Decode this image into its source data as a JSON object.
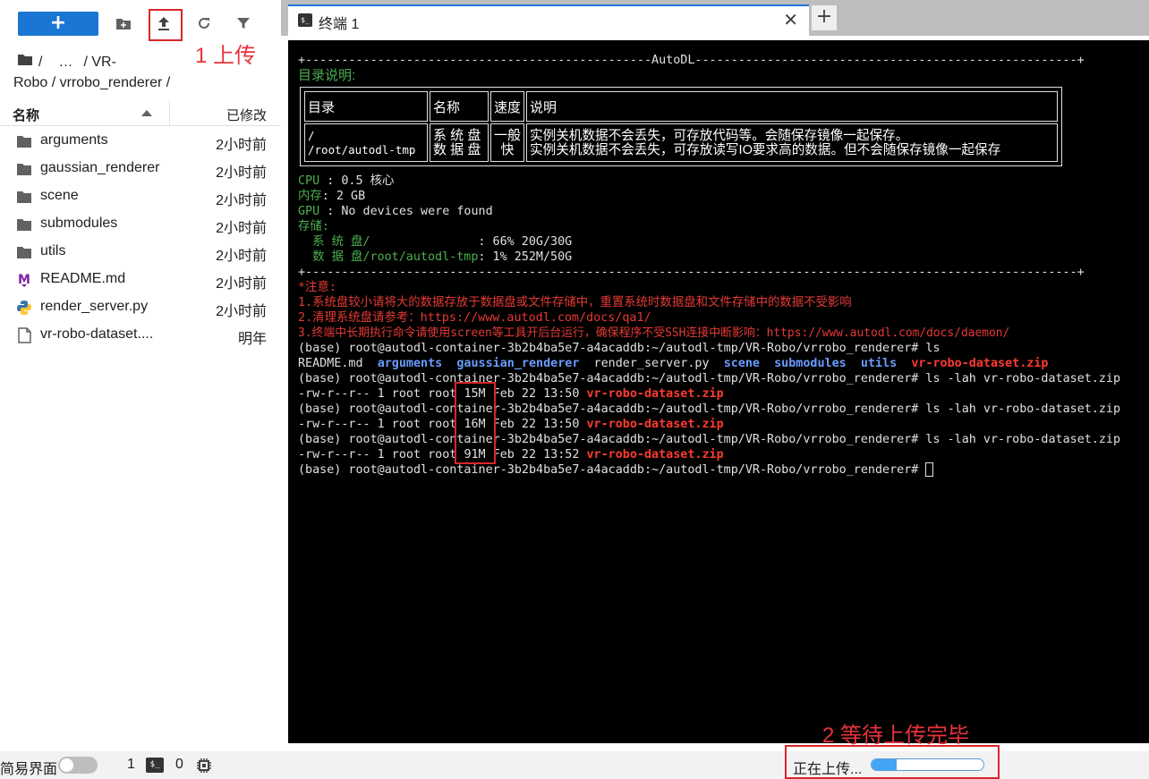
{
  "toolbar": {
    "new_label": "+",
    "icons": [
      "new-folder-icon",
      "upload-icon",
      "refresh-icon",
      "filter-icon"
    ]
  },
  "annotations": {
    "step1": "1 上传",
    "step2": "2 等待上传完毕",
    "color": "#e8333a"
  },
  "breadcrumb": {
    "root": "/",
    "ellipsis": "…",
    "line1_tail": "/ VR-",
    "line2": "Robo / vrrobo_renderer /"
  },
  "file_browser": {
    "col_name": "名称",
    "col_modified": "已修改",
    "files": [
      {
        "name": "arguments",
        "time": "2小时前",
        "icon": "folder-icon"
      },
      {
        "name": "gaussian_renderer",
        "time": "2小时前",
        "icon": "folder-icon"
      },
      {
        "name": "scene",
        "time": "2小时前",
        "icon": "folder-icon"
      },
      {
        "name": "submodules",
        "time": "2小时前",
        "icon": "folder-icon"
      },
      {
        "name": "utils",
        "time": "2小时前",
        "icon": "folder-icon"
      },
      {
        "name": "README.md",
        "time": "2小时前",
        "icon": "markdown-icon"
      },
      {
        "name": "render_server.py",
        "time": "2小时前",
        "icon": "python-icon"
      },
      {
        "name": "vr-robo-dataset....",
        "time": "明年",
        "icon": "file-icon"
      }
    ]
  },
  "tab": {
    "title": "终端 1",
    "icon_text": "$_",
    "close": "✕",
    "add": "+"
  },
  "terminal": {
    "banner_top": "+------------------------------------------------AutoDL-----------------------------------------------------+",
    "dir_title": "目录说明:",
    "table": {
      "headers": [
        "目录",
        "名称",
        "速度",
        "说明"
      ],
      "paths": [
        "/",
        "/root/autodl-tmp"
      ],
      "names": [
        "系 统 盘",
        "数 据 盘"
      ],
      "speed": [
        "一般",
        "快"
      ],
      "desc": [
        "实例关机数据不会丢失，可存放代码等。会随保存镜像一起保存。",
        "实例关机数据不会丢失，可存放读写IO要求高的数据。但不会随保存镜像一起保存"
      ]
    },
    "cpu_label": "CPU",
    "cpu_value": " : 0.5 核心",
    "mem_label": "内存",
    "mem_value": ": 2 GB",
    "gpu_label": "GPU",
    "gpu_value": " : No devices were found",
    "storage_label": "存储:",
    "sys_disk_label": "  系 统 盘/",
    "sys_disk_value": "               : 66% 20G/30G",
    "data_disk_label": "  数 据 盘/root/autodl-tmp",
    "data_disk_value": ": 1% 252M/50G",
    "banner_bottom": "+-----------------------------------------------------------------------------------------------------------+",
    "notice_title": "*注意:",
    "notice_1": "1.系统盘较小请将大的数据存放于数据盘或文件存储中，重置系统时数据盘和文件存储中的数据不受影响",
    "notice_2": "2.清理系统盘请参考：https://www.autodl.com/docs/qa1/",
    "notice_3": "3.终端中长期执行命令请使用screen等工具开后台运行，确保程序不受SSH连接中断影响：https://www.autodl.com/docs/daemon/",
    "prompt": "(base) root@autodl-container-3b2b4ba5e7-a4acaddb:~/autodl-tmp/VR-Robo/vrrobo_renderer#",
    "cmd_ls": " ls",
    "ls_plain_1": "README.md  ",
    "ls_dir_1": "arguments",
    "ls_dir_2": "gaussian_renderer",
    "ls_plain_2": "  render_server.py  ",
    "ls_dir_3": "scene",
    "ls_dir_4": "submodules",
    "ls_dir_5": "utils",
    "ls_zip": "vr-robo-dataset.zip",
    "cmd_lah": " ls -lah vr-robo-dataset.zip",
    "lah_prefix": "-rw-r--r-- 1 root root ",
    "lah_rows": [
      {
        "size": "15M",
        "date": " Feb 22 13:50 "
      },
      {
        "size": "16M",
        "date": " Feb 22 13:50 "
      },
      {
        "size": "91M",
        "date": " Feb 22 13:52 "
      }
    ]
  },
  "statusbar": {
    "simple_mode": "简易界面",
    "count_1": "1",
    "term_icon": "$_",
    "count_2": "0",
    "uploading": "正在上传...",
    "upload_progress": 0.22
  }
}
